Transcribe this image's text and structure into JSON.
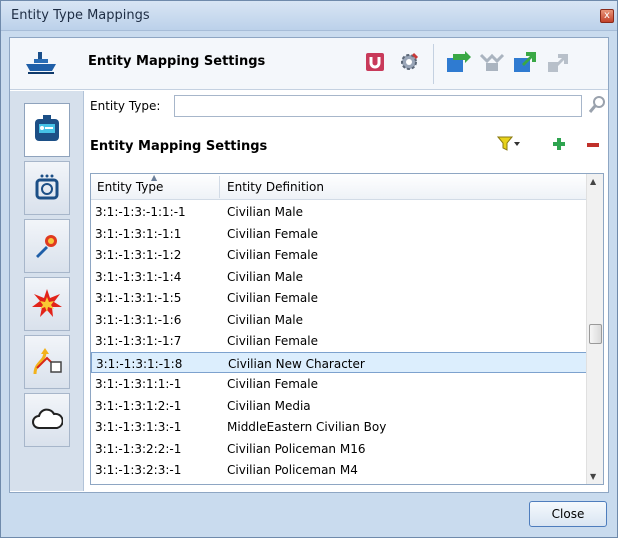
{
  "window": {
    "title": "Entity Type Mappings",
    "close_glyph": "x"
  },
  "header": {
    "heading": "Entity Mapping Settings",
    "icons": [
      "boat-icon",
      "magnet-icon",
      "gear-icon",
      "import-icon",
      "merge-icon",
      "export-icon",
      "link-icon"
    ]
  },
  "filter": {
    "label": "Entity Type:",
    "value": "",
    "placeholder": ""
  },
  "section": {
    "heading": "Entity Mapping Settings"
  },
  "table": {
    "columns": [
      "Entity Type",
      "Entity Definition"
    ],
    "sort_column": "Entity Type",
    "rows": [
      {
        "type": "3:1:-1:3:-1:1:-1",
        "definition": "Civilian Male"
      },
      {
        "type": "3:1:-1:3:1:-1:1",
        "definition": "Civilian Female"
      },
      {
        "type": "3:1:-1:3:1:-1:2",
        "definition": "Civilian Female"
      },
      {
        "type": "3:1:-1:3:1:-1:4",
        "definition": "Civilian Male"
      },
      {
        "type": "3:1:-1:3:1:-1:5",
        "definition": "Civilian Female"
      },
      {
        "type": "3:1:-1:3:1:-1:6",
        "definition": "Civilian Male"
      },
      {
        "type": "3:1:-1:3:1:-1:7",
        "definition": "Civilian Female"
      },
      {
        "type": "3:1:-1:3:1:-1:8",
        "definition": "Civilian New Character"
      },
      {
        "type": "3:1:-1:3:1:1:-1",
        "definition": "Civilian Female"
      },
      {
        "type": "3:1:-1:3:1:2:-1",
        "definition": "Civilian Media"
      },
      {
        "type": "3:1:-1:3:1:3:-1",
        "definition": "MiddleEastern Civilian Boy"
      },
      {
        "type": "3:1:-1:3:2:2:-1",
        "definition": "Civilian Policeman M16"
      },
      {
        "type": "3:1:-1:3:2:3:-1",
        "definition": "Civilian Policeman M4"
      }
    ],
    "selected_index": 7
  },
  "rail": {
    "tabs": [
      "vehicle-icon",
      "sensor-icon",
      "weapon-icon",
      "explosion-icon",
      "route-icon",
      "weather-icon"
    ],
    "active": 0
  },
  "footer": {
    "close_label": "Close"
  },
  "colors": {
    "selection": "#dceefd",
    "accent": "#4e7dbd",
    "add": "#2ea44f",
    "remove": "#c0302a"
  }
}
